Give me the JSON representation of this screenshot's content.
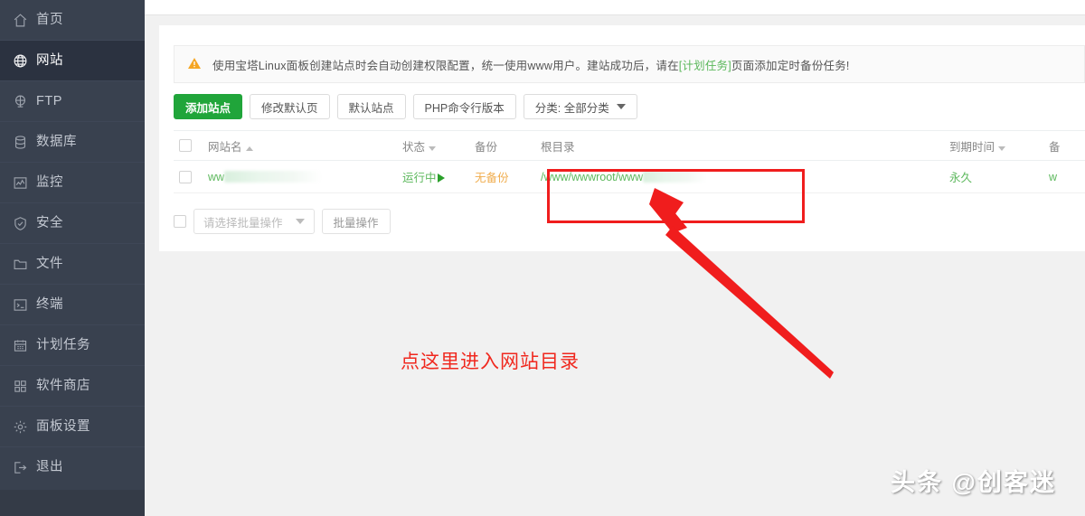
{
  "sidebar": {
    "items": [
      {
        "label": "首页",
        "icon": "home-icon",
        "active": false
      },
      {
        "label": "网站",
        "icon": "globe-icon",
        "active": true
      },
      {
        "label": "FTP",
        "icon": "ftp-icon",
        "active": false
      },
      {
        "label": "数据库",
        "icon": "database-icon",
        "active": false
      },
      {
        "label": "监控",
        "icon": "monitor-icon",
        "active": false
      },
      {
        "label": "安全",
        "icon": "shield-icon",
        "active": false
      },
      {
        "label": "文件",
        "icon": "folder-icon",
        "active": false
      },
      {
        "label": "终端",
        "icon": "terminal-icon",
        "active": false
      },
      {
        "label": "计划任务",
        "icon": "calendar-icon",
        "active": false
      },
      {
        "label": "软件商店",
        "icon": "grid-icon",
        "active": false
      },
      {
        "label": "面板设置",
        "icon": "gear-icon",
        "active": false
      },
      {
        "label": "退出",
        "icon": "logout-icon",
        "active": false
      }
    ]
  },
  "notice": {
    "icon": "warning-triangle-icon",
    "text_before": "使用宝塔Linux面板创建站点时会自动创建权限配置，统一使用www用户。建站成功后，请在",
    "link": "[计划任务]",
    "text_after": "页面添加定时备份任务!",
    "link_color": "#5cb85c"
  },
  "toolbar": {
    "add_site": "添加站点",
    "edit_default_page": "修改默认页",
    "default_site": "默认站点",
    "php_cli_version": "PHP命令行版本",
    "category": "分类: 全部分类",
    "primary_color": "#20a53a"
  },
  "table": {
    "headers": {
      "name": "网站名",
      "status": "状态",
      "backup": "备份",
      "root": "根目录",
      "expire": "到期时间",
      "note": "备"
    },
    "sort": {
      "name": "asc",
      "status": "desc",
      "expire": "desc"
    },
    "rows": [
      {
        "name_visible": "ww",
        "name_redacted": true,
        "status": "运行中",
        "status_icon": "play-icon",
        "backup": "无备份",
        "root_visible": "/www/wwwroot/www",
        "root_redacted": true,
        "expire": "永久",
        "note_visible": "w",
        "status_color": "#5cb85c",
        "backup_color": "#f0ad4e",
        "root_color": "#5cb85c",
        "expire_color": "#5cb85c"
      }
    ]
  },
  "batch": {
    "select_placeholder": "请选择批量操作",
    "button": "批量操作"
  },
  "annotation": {
    "text": "点这里进入网站目录",
    "color": "#f0281e",
    "highlight_color": "#f01d1d"
  },
  "watermark": {
    "text": "头条 @创客迷"
  }
}
